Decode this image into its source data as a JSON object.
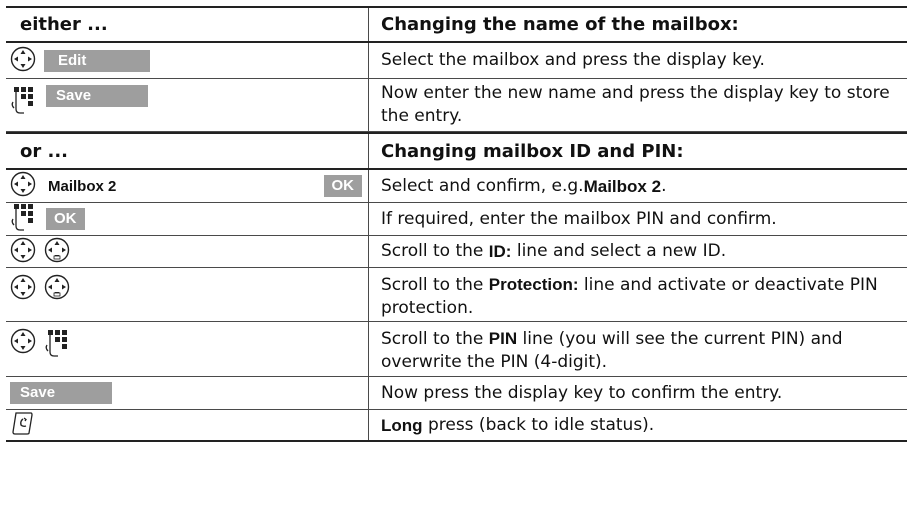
{
  "header1": {
    "left": "either ...",
    "right": "Changing the name of the mailbox:"
  },
  "row_edit": {
    "key": "Edit",
    "text": "Select the mailbox and press the display key."
  },
  "row_save": {
    "key": "Save",
    "text": "Now enter the new name and press the display key to store the entry."
  },
  "header2": {
    "left": "or ...",
    "right": "Changing mailbox ID and PIN:"
  },
  "row_mailbox": {
    "label": "Mailbox 2",
    "key": "OK",
    "text_before": "Select and confirm, e.g. ",
    "text_bold": "Mailbox 2",
    "text_after": "."
  },
  "row_pin": {
    "key": "OK",
    "text": "If required, enter the mailbox PIN and confirm."
  },
  "row_id": {
    "text_before": "Scroll to the ",
    "text_bold": "ID:",
    "text_after": " line and select a new ID."
  },
  "row_protection": {
    "text_before": "Scroll to the ",
    "text_bold": "Protection:",
    "text_after": " line and activate or deactivate PIN protection."
  },
  "row_pinline": {
    "text_before": "Scroll to the ",
    "text_bold": "PIN",
    "text_after": " line (you will see the current PIN) and overwrite the PIN (4-digit)."
  },
  "row_save2": {
    "key": "Save",
    "text": "Now press the display key to confirm the entry."
  },
  "row_end": {
    "text_bold": "Long",
    "text_after": " press (back to idle status)."
  },
  "icons": {
    "nav": "control-key-icon",
    "keypad": "keypad-icon",
    "end": "end-call-key-icon"
  }
}
